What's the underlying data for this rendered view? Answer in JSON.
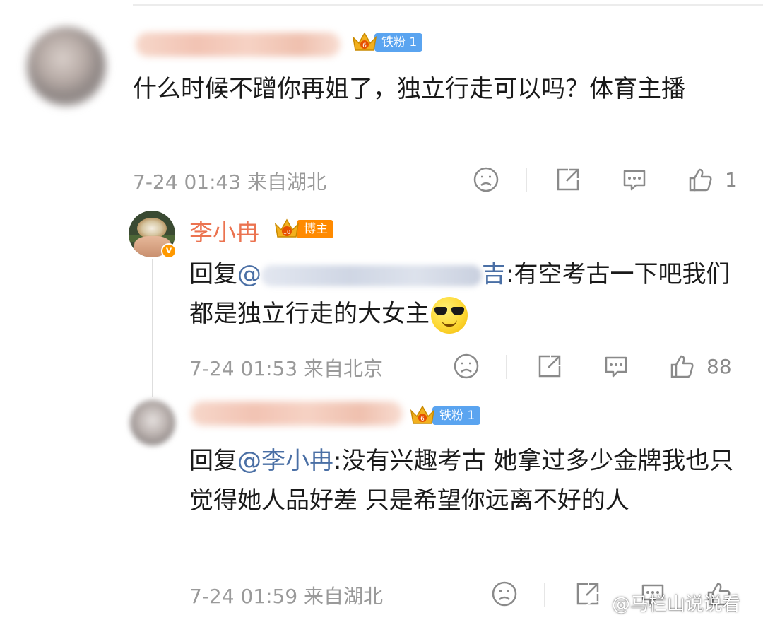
{
  "comments": [
    {
      "badge": "铁粉 1",
      "badge_level": "6",
      "text": "什么时候不蹭你再姐了，独立行走可以吗？体育主播",
      "meta": "7-24 01:43  来自湖北",
      "likes": "1"
    },
    {
      "username": "李小冉",
      "verified_mark": "v",
      "badge": "博主",
      "badge_level": "10",
      "reply_prefix": "回复",
      "mention_at": "@",
      "mention_tail": "吉",
      "text": ":有空考古一下吧我们都是独立行走的大女主",
      "emoji": "cool-sunglasses-emoji",
      "meta": "7-24 01:53  来自北京",
      "likes": "88"
    },
    {
      "badge": "铁粉 1",
      "badge_level": "6",
      "reply_prefix": "回复",
      "mention": "@李小冉",
      "text": ":没有兴趣考古 她拿过多少金牌我也只觉得她人品好差 只是希望你远离不好的人",
      "meta": "7-24 01:59  来自湖北",
      "likes": ""
    }
  ],
  "watermark": "@马栏山说说看",
  "icons": [
    "sad-face-icon",
    "share-icon",
    "comment-icon",
    "thumbs-up-icon",
    "crown-badge-icon",
    "weibo-logo-icon"
  ],
  "colors": {
    "username": "#eb7350",
    "mention": "#4a6fa5",
    "fan_badge": "#5aa4f0",
    "host_badge": "#ff8a00",
    "verified": "#ff9900",
    "meta": "#9a9a9a"
  }
}
